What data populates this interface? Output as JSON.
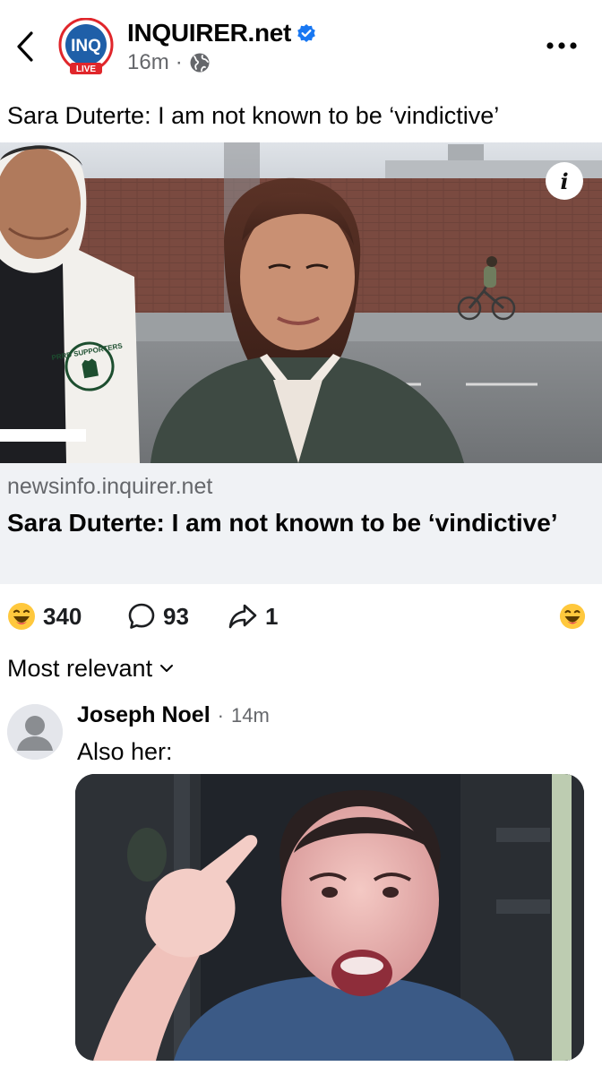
{
  "header": {
    "page_name": "INQUIRER.net",
    "timestamp": "16m",
    "separator": "·",
    "logo_text": "INQ",
    "logo_badge": "LIVE",
    "verified_icon": "verified-badge-icon",
    "audience_icon": "globe-icon",
    "back_icon": "chevron-left-icon",
    "more_icon": "more-dots-icon"
  },
  "post": {
    "text": "Sara Duterte: I am not known to be ‘vindictive’"
  },
  "link_preview": {
    "image_icon": "info-icon",
    "info_label": "i",
    "domain": "newsinfo.inquirer.net",
    "title": "Sara Duterte: I am not known to be ‘vindictive’",
    "cutout_text": "PRRD SUPPORTERS"
  },
  "stats": {
    "reactions_count": "340",
    "comments_count": "93",
    "shares_count": "1",
    "reaction_icon": "haha-emoji-icon",
    "comment_icon": "comment-bubble-icon",
    "share_icon": "share-arrow-icon"
  },
  "comments_section": {
    "sort_label": "Most relevant",
    "sort_icon": "chevron-down-icon"
  },
  "comment": {
    "author": "Joseph Noel",
    "separator": "·",
    "time": "14m",
    "text": "Also her:"
  },
  "colors": {
    "brand_blue": "#1877f2",
    "inq_red": "#e0262b",
    "secondary_text": "#65676b",
    "link_bg": "#f0f2f5",
    "emoji_yellow": "#ffc83d"
  }
}
